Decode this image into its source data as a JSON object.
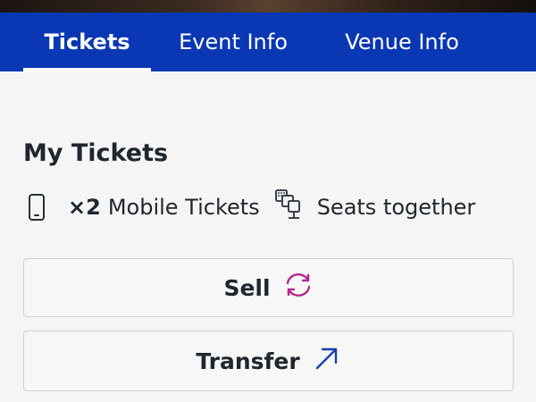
{
  "tabs": [
    {
      "label": "Tickets",
      "active": true
    },
    {
      "label": "Event Info",
      "active": false
    },
    {
      "label": "Venue Info",
      "active": false
    }
  ],
  "my_tickets": {
    "title": "My Tickets",
    "quantity": "×2",
    "ticket_type": "Mobile Tickets",
    "seats_note": "Seats together"
  },
  "actions": {
    "sell_label": "Sell",
    "transfer_label": "Transfer"
  },
  "icons": {
    "ticket_type": "mobile-phone-icon",
    "seats": "seats-together-icon",
    "sell": "sync-arrows-icon",
    "transfer": "arrow-up-right-icon"
  },
  "colors": {
    "tab_bar": "#0a37b3",
    "sell_icon": "#b4298f",
    "transfer_icon": "#1a3fa8"
  }
}
